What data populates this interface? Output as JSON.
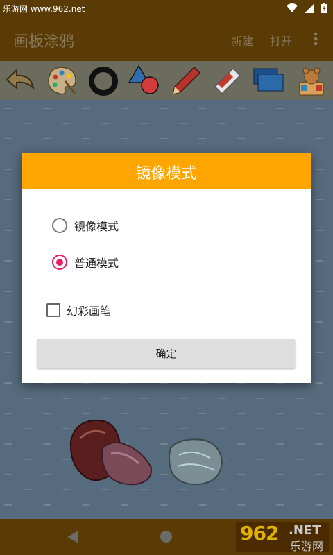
{
  "status_bar": {
    "watermark_text": "乐游网 www.962.net",
    "icons": [
      "wifi-icon",
      "signal-icon",
      "battery-icon"
    ]
  },
  "app_bar": {
    "title": "画板涂鸦",
    "actions": {
      "new": "新建",
      "open": "打开"
    },
    "overflow_icon": "more-vert-icon"
  },
  "toolbar": {
    "tools": [
      "undo-arrow-icon",
      "palette-icon",
      "ring-icon",
      "shapes-icon",
      "pencil-icon",
      "eraser-icon",
      "layers-icon",
      "teddy-bear-icon"
    ]
  },
  "dialog": {
    "title": "镜像模式",
    "options": [
      {
        "label": "镜像模式",
        "selected": false
      },
      {
        "label": "普通模式",
        "selected": true
      }
    ],
    "checkbox": {
      "label": "幻彩画笔",
      "checked": false
    },
    "confirm_label": "确定"
  },
  "nav_bar": {
    "icons": [
      "back-icon",
      "home-icon"
    ],
    "watermark": {
      "number": "962",
      "suffix": ".NET",
      "name": "乐游网"
    }
  },
  "colors": {
    "accent_header": "#ffa500",
    "radio_selected": "#e91e63",
    "bars": "#5a3b05"
  }
}
